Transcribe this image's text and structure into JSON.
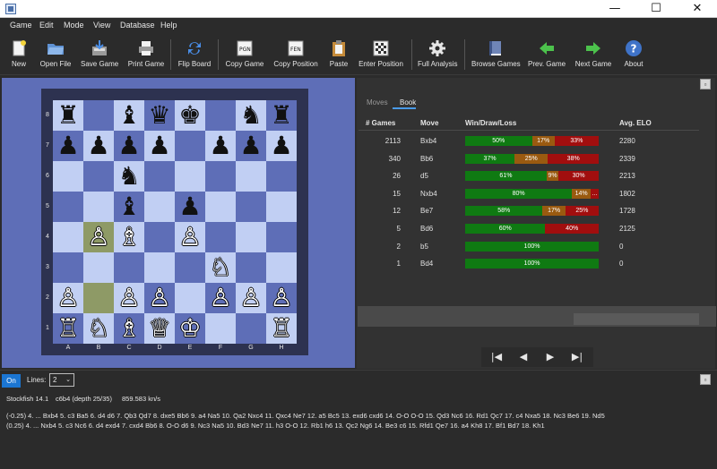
{
  "window": {
    "minimize": "—",
    "maximize": "☐",
    "close": "✕"
  },
  "menu": [
    "Game",
    "Edit",
    "Mode",
    "View",
    "Database",
    "Help"
  ],
  "toolbar": [
    {
      "label": "New",
      "icon": "new-document-icon"
    },
    {
      "label": "Open File",
      "icon": "folder-icon"
    },
    {
      "label": "Save Game",
      "icon": "save-icon"
    },
    {
      "label": "Print Game",
      "icon": "printer-icon"
    },
    {
      "label": "Flip Board",
      "icon": "flip-icon"
    },
    {
      "label": "Copy Game",
      "icon": "copy-pgn-icon"
    },
    {
      "label": "Copy Position",
      "icon": "copy-fen-icon"
    },
    {
      "label": "Paste",
      "icon": "clipboard-icon"
    },
    {
      "label": "Enter Position",
      "icon": "board-edit-icon"
    },
    {
      "label": "Full Analysis",
      "icon": "gear-icon"
    },
    {
      "label": "Browse Games",
      "icon": "book-icon"
    },
    {
      "label": "Prev. Game",
      "icon": "arrow-left-icon"
    },
    {
      "label": "Next Game",
      "icon": "arrow-right-icon"
    },
    {
      "label": "About",
      "icon": "help-icon"
    }
  ],
  "board": {
    "ranks": [
      "8",
      "7",
      "6",
      "5",
      "4",
      "3",
      "2",
      "1"
    ],
    "files": [
      "A",
      "B",
      "C",
      "D",
      "E",
      "F",
      "G",
      "H"
    ],
    "pieces": [
      {
        "square": "a8",
        "glyph": "♜",
        "color": "black"
      },
      {
        "square": "c8",
        "glyph": "♝",
        "color": "black"
      },
      {
        "square": "d8",
        "glyph": "♛",
        "color": "black"
      },
      {
        "square": "e8",
        "glyph": "♚",
        "color": "black"
      },
      {
        "square": "g8",
        "glyph": "♞",
        "color": "black"
      },
      {
        "square": "h8",
        "glyph": "♜",
        "color": "black"
      },
      {
        "square": "a7",
        "glyph": "♟",
        "color": "black"
      },
      {
        "square": "b7",
        "glyph": "♟",
        "color": "black"
      },
      {
        "square": "c7",
        "glyph": "♟",
        "color": "black"
      },
      {
        "square": "d7",
        "glyph": "♟",
        "color": "black"
      },
      {
        "square": "f7",
        "glyph": "♟",
        "color": "black"
      },
      {
        "square": "g7",
        "glyph": "♟",
        "color": "black"
      },
      {
        "square": "h7",
        "glyph": "♟",
        "color": "black"
      },
      {
        "square": "c6",
        "glyph": "♞",
        "color": "black"
      },
      {
        "square": "c5",
        "glyph": "♝",
        "color": "black"
      },
      {
        "square": "e5",
        "glyph": "♟",
        "color": "black"
      },
      {
        "square": "b4",
        "glyph": "♙",
        "color": "white"
      },
      {
        "square": "c4",
        "glyph": "♗",
        "color": "white"
      },
      {
        "square": "e4",
        "glyph": "♙",
        "color": "white"
      },
      {
        "square": "f3",
        "glyph": "♘",
        "color": "white"
      },
      {
        "square": "a2",
        "glyph": "♙",
        "color": "white"
      },
      {
        "square": "c2",
        "glyph": "♙",
        "color": "white"
      },
      {
        "square": "d2",
        "glyph": "♙",
        "color": "white"
      },
      {
        "square": "f2",
        "glyph": "♙",
        "color": "white"
      },
      {
        "square": "g2",
        "glyph": "♙",
        "color": "white"
      },
      {
        "square": "h2",
        "glyph": "♙",
        "color": "white"
      },
      {
        "square": "a1",
        "glyph": "♖",
        "color": "white"
      },
      {
        "square": "b1",
        "glyph": "♘",
        "color": "white"
      },
      {
        "square": "c1",
        "glyph": "♗",
        "color": "white"
      },
      {
        "square": "d1",
        "glyph": "♕",
        "color": "white"
      },
      {
        "square": "e1",
        "glyph": "♔",
        "color": "white"
      },
      {
        "square": "h1",
        "glyph": "♖",
        "color": "white"
      }
    ],
    "highlighted": [
      "b4",
      "b2"
    ]
  },
  "tabs": [
    {
      "label": "Moves",
      "active": false
    },
    {
      "label": "Book",
      "active": true
    }
  ],
  "book": {
    "headers": [
      "# Games",
      "Move",
      "Win/Draw/Loss",
      "Avg. ELO"
    ],
    "rows": [
      {
        "games": "2113",
        "move": "Bxb4",
        "win": 50,
        "draw": 17,
        "loss": 33,
        "win_label": "50%",
        "draw_label": "17%",
        "loss_label": "33%",
        "elo": "2280"
      },
      {
        "games": "340",
        "move": "Bb6",
        "win": 37,
        "draw": 25,
        "loss": 38,
        "win_label": "37%",
        "draw_label": "25%",
        "loss_label": "38%",
        "elo": "2339"
      },
      {
        "games": "26",
        "move": "d5",
        "win": 61,
        "draw": 9,
        "loss": 30,
        "win_label": "61%",
        "draw_label": "9%",
        "loss_label": "30%",
        "elo": "2213"
      },
      {
        "games": "15",
        "move": "Nxb4",
        "win": 80,
        "draw": 14,
        "loss": 6,
        "win_label": "80%",
        "draw_label": "14%",
        "loss_label": "...",
        "elo": "1802"
      },
      {
        "games": "12",
        "move": "Be7",
        "win": 58,
        "draw": 17,
        "loss": 25,
        "win_label": "58%",
        "draw_label": "17%",
        "loss_label": "25%",
        "elo": "1728"
      },
      {
        "games": "5",
        "move": "Bd6",
        "win": 60,
        "draw": 0,
        "loss": 40,
        "win_label": "60%",
        "draw_label": "",
        "loss_label": "40%",
        "elo": "2125"
      },
      {
        "games": "2",
        "move": "b5",
        "win": 100,
        "draw": 0,
        "loss": 0,
        "win_label": "100%",
        "draw_label": "",
        "loss_label": "",
        "elo": "0"
      },
      {
        "games": "1",
        "move": "Bd4",
        "win": 100,
        "draw": 0,
        "loss": 0,
        "win_label": "100%",
        "draw_label": "",
        "loss_label": "",
        "elo": "0"
      }
    ]
  },
  "nav": {
    "first": "|◀",
    "prev": "◀",
    "next": "▶",
    "last": "▶|"
  },
  "engine": {
    "on_label": "On",
    "lines_label": "Lines:",
    "lines_value": "2",
    "name": "Stockfish 14.1",
    "move": "c6b4 (depth 25/35)",
    "speed": "859.583 kn/s",
    "pv": [
      "(-0.25) 4. ... Bxb4 5. c3 Ba5 6. d4 d6 7. Qb3 Qd7 8. dxe5 Bb6 9. a4 Na5 10. Qa2 Nxc4 11. Qxc4 Ne7 12. a5 Bc5 13. exd6 cxd6 14. O-O O-O 15. Qd3 Nc6 16. Rd1 Qc7 17. c4 Nxa5 18. Nc3 Be6 19. Nd5",
      "(0.25) 4. ... Nxb4 5. c3 Nc6 6. d4 exd4 7. cxd4 Bb6 8. O-O d6 9. Nc3 Na5 10. Bd3 Ne7 11. h3 O-O 12. Rb1 h6 13. Qc2 Ng6 14. Be3 c6 15. Rfd1 Qe7 16. a4 Kh8 17. Bf1 Bd7 18. Kh1"
    ]
  }
}
